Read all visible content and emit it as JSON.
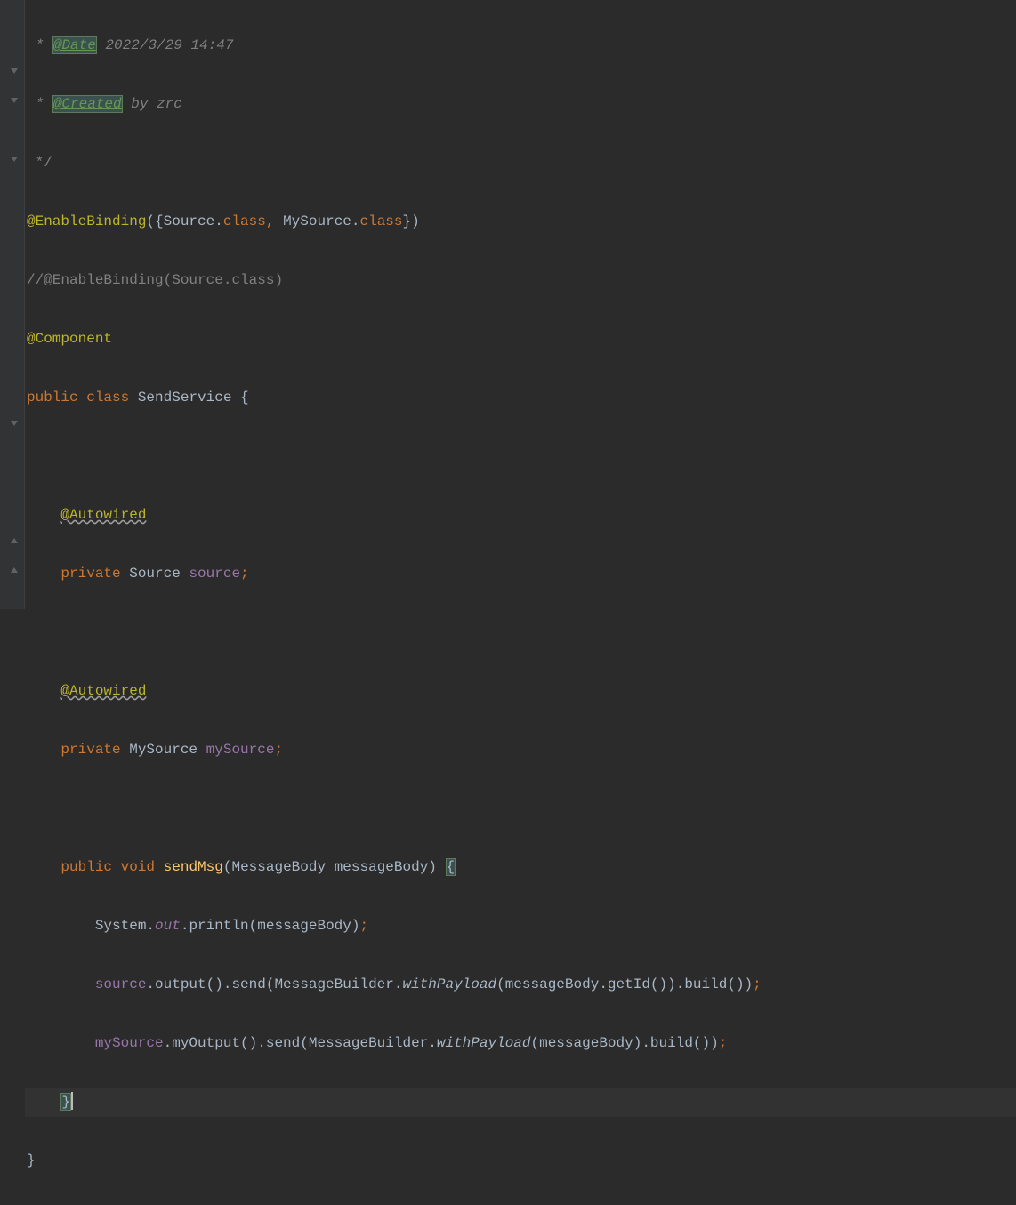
{
  "lines": {
    "l1_star": " * ",
    "l1_date_tag": "@Date",
    "l1_date_text": " 2022/3/29 14:47",
    "l2_star": " * ",
    "l2_created_tag": "@Created",
    "l2_created_text": " by zrc",
    "l3": " */",
    "l4_anno": "@EnableBinding",
    "l4_p1": "({Source.",
    "l4_class1": "class",
    "l4_comma": ", ",
    "l4_p2": "MySource.",
    "l4_class2": "class",
    "l4_p3": "})",
    "l5": "//@EnableBinding(Source.class)",
    "l6": "@Component",
    "l7_kw": "public class ",
    "l7_name": "SendService {",
    "l8": "",
    "l9_indent": "    ",
    "l9_anno": "@Autowired",
    "l10_indent": "    ",
    "l10_kw": "private ",
    "l10_type": "Source ",
    "l10_name": "source",
    "l10_semi": ";",
    "l11": "",
    "l12_indent": "    ",
    "l12_anno": "@Autowired",
    "l13_indent": "    ",
    "l13_kw": "private ",
    "l13_type": "MySource ",
    "l13_name": "mySource",
    "l13_semi": ";",
    "l14": "",
    "l15_indent": "    ",
    "l15_kw1": "public ",
    "l15_kw2": "void ",
    "l15_method": "sendMsg",
    "l15_params": "(MessageBody messageBody) ",
    "l15_brace": "{",
    "l16_indent": "        ",
    "l16_p1": "System.",
    "l16_out": "out",
    "l16_p2": ".println(messageBody)",
    "l16_semi": ";",
    "l17_indent": "        ",
    "l17_src": "source",
    "l17_p1": ".output().send(MessageBuilder.",
    "l17_wp": "withPayload",
    "l17_p2": "(messageBody.getId()).build())",
    "l17_semi": ";",
    "l18_indent": "        ",
    "l18_my": "mySource",
    "l18_p1": ".myOutput().send(MessageBuilder.",
    "l18_wp": "withPayload",
    "l18_p2": "(messageBody).build())",
    "l18_semi": ";",
    "l19_indent": "    ",
    "l19_brace": "}",
    "l20": "}"
  }
}
